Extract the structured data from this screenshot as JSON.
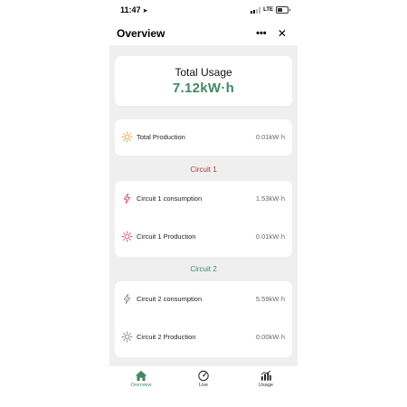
{
  "status_bar": {
    "time": "11:47",
    "network": "LTE"
  },
  "header": {
    "title": "Overview",
    "more_label": "•••",
    "close_label": "✕"
  },
  "total_usage": {
    "label": "Total Usage",
    "value": "7.12kW·h"
  },
  "total_production": {
    "label": "Total Production",
    "value": "0.01kW·h",
    "icon": "sun-icon"
  },
  "circuit1": {
    "title": "Circuit 1",
    "rows": [
      {
        "label": "Circuit 1 consumption",
        "value": "1.53kW·h",
        "icon": "lightning-icon"
      },
      {
        "label": "Circuit 1 Production",
        "value": "0.01kW·h",
        "icon": "sun-icon"
      }
    ]
  },
  "circuit2": {
    "title": "Circuit 2",
    "rows": [
      {
        "label": "Circuit 2 consumption",
        "value": "5.59kW·h",
        "icon": "lightning-icon"
      },
      {
        "label": "Circuit 2 Production",
        "value": "0.00kW·h",
        "icon": "sun-icon"
      }
    ]
  },
  "nav": {
    "items": [
      {
        "label": "Overview",
        "icon": "home-icon",
        "active": true
      },
      {
        "label": "Live",
        "icon": "gauge-icon",
        "active": false
      },
      {
        "label": "Usage",
        "icon": "bar-chart-icon",
        "active": false
      }
    ]
  },
  "colors": {
    "accent_green": "#3f8a63",
    "circuit1_red": "#b03a3a",
    "sun_orange": "#e8a33a",
    "background": "#efefef"
  }
}
